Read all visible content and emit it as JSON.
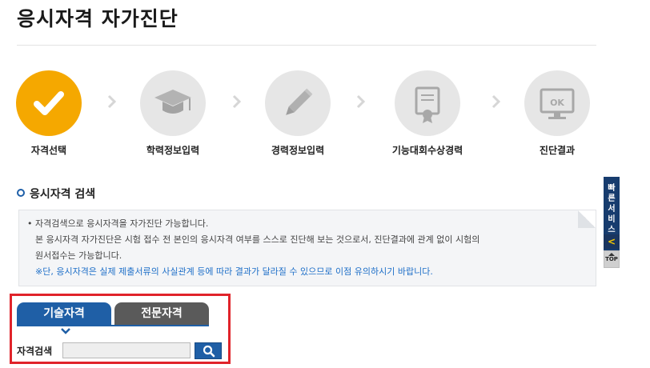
{
  "page": {
    "title": "응시자격 자가진단"
  },
  "steps": [
    {
      "label": "자격선택",
      "icon": "check-icon",
      "active": true
    },
    {
      "label": "학력정보입력",
      "icon": "graduation-cap-icon",
      "active": false
    },
    {
      "label": "경력정보입력",
      "icon": "pencil-icon",
      "active": false
    },
    {
      "label": "기능대회수상경력",
      "icon": "certificate-icon",
      "active": false
    },
    {
      "label": "진단결과",
      "icon": "monitor-ok-icon",
      "active": false
    }
  ],
  "step_icons": {
    "monitor_text": "OK"
  },
  "section": {
    "title": "응시자격 검색"
  },
  "notice": {
    "line1": "• 자격검색으로 응시자격을 자가진단 가능합니다.",
    "line2": "본 응시자격 자가진단은 시험 접수 전 본인의 응시자격 여부를 스스로 진단해 보는 것으로서, 진단결과에 관계 없이 시험의",
    "line3": "원서접수는 가능합니다.",
    "warning": "※단, 응시자격은 실제 제출서류의 사실관계 등에 따라 결과가 달라질 수 있으므로 이점 유의하시기 바랍니다."
  },
  "quick_service": {
    "label": "빠른서비스",
    "top_label": "TOP"
  },
  "tabs": [
    {
      "label": "기술자격",
      "active": true
    },
    {
      "label": "전문자격",
      "active": false
    }
  ],
  "search": {
    "label": "자격검색",
    "value": "",
    "placeholder": ""
  },
  "colors": {
    "accent": "#1f5fa6",
    "active_step": "#f5a800",
    "highlight": "#e0232a",
    "warning_text": "#1e6fc8"
  }
}
